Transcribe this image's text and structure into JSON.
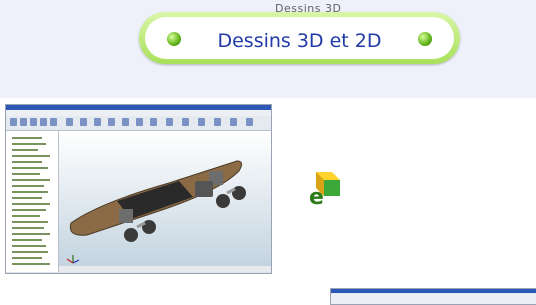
{
  "header": {
    "faded_text": "Dessins 3D",
    "banner_title": "Dessins 3D et 2D"
  },
  "icons": {
    "ball_left": "green-ball-icon",
    "ball_right": "green-ball-icon",
    "edrawings": "edrawings-e-cube-icon",
    "triad": "coordinate-triad-icon"
  },
  "colors": {
    "banner_border": "#a8e05a",
    "title_text": "#203aa6",
    "top_band": "#eef0fa",
    "skateboard_deck": "#8a6b45",
    "cad_titlebar": "#2c59b6"
  }
}
